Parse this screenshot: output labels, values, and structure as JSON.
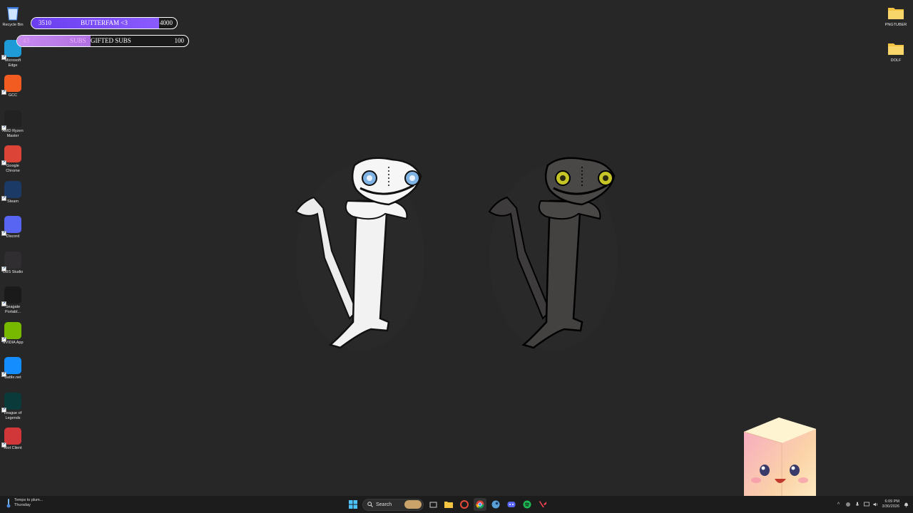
{
  "desktop": {
    "left_icons": [
      {
        "label": "Recycle Bin",
        "icon": "recycle-bin-icon",
        "color": "#3b78d8"
      },
      {
        "label": "Microsoft Edge",
        "icon": "edge-icon",
        "color": "#1f9bd8"
      },
      {
        "label": "GCC",
        "icon": "gcc-icon",
        "color": "#f25c20"
      },
      {
        "label": "AMD Ryzen Master",
        "icon": "amd-ryzen-icon",
        "color": "#222222"
      },
      {
        "label": "Google Chrome",
        "icon": "chrome-icon",
        "color": "#db4437"
      },
      {
        "label": "Steam",
        "icon": "steam-icon",
        "color": "#1b3a66"
      },
      {
        "label": "Discord",
        "icon": "discord-icon",
        "color": "#5865f2"
      },
      {
        "label": "OBS Studio",
        "icon": "obs-icon",
        "color": "#302e31"
      },
      {
        "label": "Seagate Portabl...",
        "icon": "seagate-icon",
        "color": "#1a1a1a"
      },
      {
        "label": "NVIDIA App",
        "icon": "nvidia-icon",
        "color": "#76b900"
      },
      {
        "label": "Battle.net",
        "icon": "battlenet-icon",
        "color": "#148eff"
      },
      {
        "label": "League of Legends",
        "icon": "league-icon",
        "color": "#0a3a3a"
      },
      {
        "label": "Riot Client",
        "icon": "riot-icon",
        "color": "#d13639"
      }
    ],
    "right_icons": [
      {
        "label": "PNGTUBER",
        "icon": "folder-icon",
        "color": "#f4c542"
      },
      {
        "label": "DOLF",
        "icon": "folder-icon",
        "color": "#f4c542"
      }
    ]
  },
  "goals": {
    "follower": {
      "current": "3510",
      "title": "BUTTERFAM <3",
      "target": "4000",
      "progress": 0.8775,
      "color": "#6a3df0"
    },
    "subs": {
      "current": "43",
      "label": "SUBS",
      "title": "GIFTED SUBS",
      "target": "100",
      "progress": 0.43,
      "color": "#c98cf0"
    }
  },
  "taskbar": {
    "weather_line1": "Temps to plum...",
    "weather_line2": "Thursday",
    "search_placeholder": "Search",
    "time": "6:09 PM",
    "date": "3/30/2026"
  }
}
